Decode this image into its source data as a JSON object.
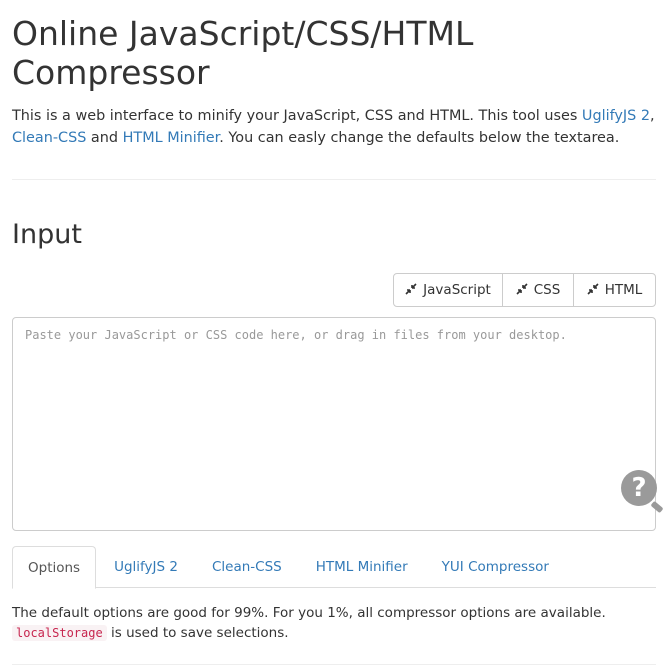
{
  "page": {
    "title": "Online JavaScript/CSS/HTML Compressor",
    "intro": {
      "text1": "This is a web interface to minify your JavaScript, CSS and HTML. This tool uses ",
      "link_uglify": "UglifyJS 2",
      "sep1": ", ",
      "link_cleancss": "Clean-CSS",
      "sep2": " and ",
      "link_htmlminifier": "HTML Minifier",
      "text2": ". You can easly change the defaults below the textarea."
    }
  },
  "input": {
    "heading": "Input",
    "buttons": [
      {
        "label": "JavaScript",
        "icon": "compress-icon"
      },
      {
        "label": "CSS",
        "icon": "compress-icon"
      },
      {
        "label": "HTML",
        "icon": "compress-icon"
      }
    ],
    "textarea_placeholder": "Paste your JavaScript or CSS code here, or drag in files from your desktop.",
    "textarea_value": "",
    "help_icon_glyph": "?"
  },
  "tabs": [
    {
      "label": "Options",
      "active": true
    },
    {
      "label": "UglifyJS 2"
    },
    {
      "label": "Clean-CSS"
    },
    {
      "label": "HTML Minifier"
    },
    {
      "label": "YUI Compressor"
    }
  ],
  "options_panel": {
    "line1": "The default options are good for 99%. For you 1%, all compressor options are available.",
    "code": "localStorage",
    "line2": " is used to save selections."
  },
  "colors": {
    "link": "#337ab7",
    "code_text": "#c7254e",
    "code_bg": "#f9f2f4",
    "border": "#cccccc"
  }
}
